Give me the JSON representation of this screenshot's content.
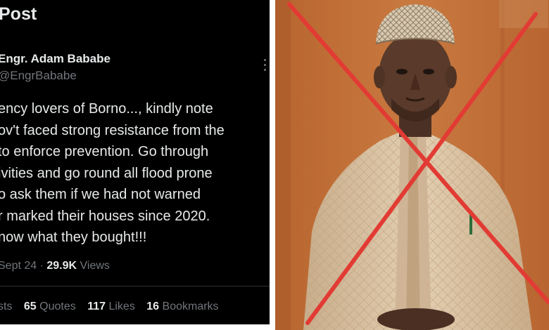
{
  "tweet": {
    "header_title": "Post",
    "author_name": "Engr. Adam Bababe",
    "author_handle": "@EngrBababe",
    "body_lines": [
      "ency lovers of Borno..., kindly note",
      "ov't faced strong resistance from the",
      "to enforce prevention. Go through",
      "ivities and go round all flood prone",
      "o ask them if we had not warned",
      "r marked their houses since 2020.",
      "now what they bought!!!"
    ],
    "date": "Sept 24",
    "separator": " · ",
    "views_count": "29.9K",
    "views_label": " Views",
    "stats": {
      "reposts_label": "sts",
      "quotes_count": "65",
      "quotes_label": "Quotes",
      "likes_count": "117",
      "likes_label": "Likes",
      "bookmarks_count": "16",
      "bookmarks_label": "Bookmarks"
    },
    "more_icon": "more-vertical-icon"
  },
  "photo": {
    "overlay_mark": "red-x-cross",
    "colors": {
      "wall": "#c0703a",
      "robe": "#d9c3a4",
      "cap": "#d8c9b0",
      "skin": "#5a3a2a",
      "cross": "#e23b34"
    }
  }
}
